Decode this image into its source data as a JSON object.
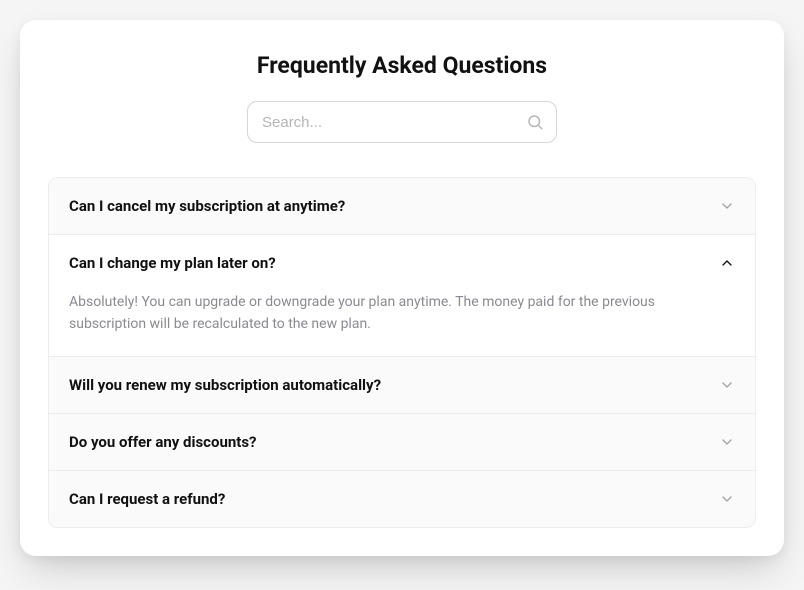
{
  "title": "Frequently Asked Questions",
  "search": {
    "placeholder": "Search..."
  },
  "faq": [
    {
      "question": "Can I cancel my subscription at anytime?",
      "answer": "",
      "open": false
    },
    {
      "question": "Can I change my plan later on?",
      "answer": "Absolutely! You can upgrade or downgrade your plan anytime. The money paid for the previous subscription will be recalculated to the new plan.",
      "open": true
    },
    {
      "question": "Will you renew my subscription automatically?",
      "answer": "",
      "open": false
    },
    {
      "question": "Do you offer any discounts?",
      "answer": "",
      "open": false
    },
    {
      "question": "Can I request a refund?",
      "answer": "",
      "open": false
    }
  ]
}
